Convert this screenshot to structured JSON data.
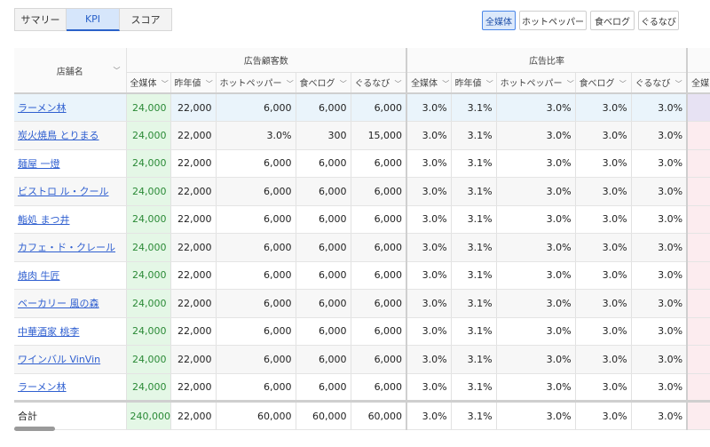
{
  "tabs": [
    {
      "label": "サマリー"
    },
    {
      "label": "KPI"
    },
    {
      "label": "スコア"
    }
  ],
  "filters": [
    {
      "label": "全媒体"
    },
    {
      "label": "ホットペッパー"
    },
    {
      "label": "食べログ"
    },
    {
      "label": "ぐるなび"
    }
  ],
  "header": {
    "store": "店舗名",
    "group1": "広告顧客数",
    "group2": "広告比率",
    "sub": [
      "全媒体",
      "昨年値",
      "ホットペッパー",
      "食べログ",
      "ぐるなび"
    ],
    "next_sub": "全媒"
  },
  "rows": [
    {
      "store": "ラーメン林",
      "c": [
        "24,000",
        "22,000",
        "6,000",
        "6,000",
        "6,000"
      ],
      "r": [
        "3.0%",
        "3.1%",
        "3.0%",
        "3.0%",
        "3.0%"
      ]
    },
    {
      "store": "炭火焼鳥 とりまる",
      "c": [
        "24,000",
        "22,000",
        "3.0%",
        "300",
        "15,000"
      ],
      "r": [
        "3.0%",
        "3.1%",
        "3.0%",
        "3.0%",
        "3.0%"
      ]
    },
    {
      "store": "麺屋 一燈",
      "c": [
        "24,000",
        "22,000",
        "6,000",
        "6,000",
        "6,000"
      ],
      "r": [
        "3.0%",
        "3.1%",
        "3.0%",
        "3.0%",
        "3.0%"
      ]
    },
    {
      "store": "ビストロ ル・クール",
      "c": [
        "24,000",
        "22,000",
        "6,000",
        "6,000",
        "6,000"
      ],
      "r": [
        "3.0%",
        "3.1%",
        "3.0%",
        "3.0%",
        "3.0%"
      ]
    },
    {
      "store": "鮨処 まつ井",
      "c": [
        "24,000",
        "22,000",
        "6,000",
        "6,000",
        "6,000"
      ],
      "r": [
        "3.0%",
        "3.1%",
        "3.0%",
        "3.0%",
        "3.0%"
      ]
    },
    {
      "store": "カフェ・ド・クレール",
      "c": [
        "24,000",
        "22,000",
        "6,000",
        "6,000",
        "6,000"
      ],
      "r": [
        "3.0%",
        "3.1%",
        "3.0%",
        "3.0%",
        "3.0%"
      ]
    },
    {
      "store": "焼肉 牛匠",
      "c": [
        "24,000",
        "22,000",
        "6,000",
        "6,000",
        "6,000"
      ],
      "r": [
        "3.0%",
        "3.1%",
        "3.0%",
        "3.0%",
        "3.0%"
      ]
    },
    {
      "store": "ベーカリー 風の森",
      "c": [
        "24,000",
        "22,000",
        "6,000",
        "6,000",
        "6,000"
      ],
      "r": [
        "3.0%",
        "3.1%",
        "3.0%",
        "3.0%",
        "3.0%"
      ]
    },
    {
      "store": "中華酒家 桃李",
      "c": [
        "24,000",
        "22,000",
        "6,000",
        "6,000",
        "6,000"
      ],
      "r": [
        "3.0%",
        "3.1%",
        "3.0%",
        "3.0%",
        "3.0%"
      ]
    },
    {
      "store": "ワインバル VinVin",
      "c": [
        "24,000",
        "22,000",
        "6,000",
        "6,000",
        "6,000"
      ],
      "r": [
        "3.0%",
        "3.1%",
        "3.0%",
        "3.0%",
        "3.0%"
      ]
    },
    {
      "store": "ラーメン林",
      "c": [
        "24,000",
        "22,000",
        "6,000",
        "6,000",
        "6,000"
      ],
      "r": [
        "3.0%",
        "3.1%",
        "3.0%",
        "3.0%",
        "3.0%"
      ]
    }
  ],
  "total": {
    "label": "合計",
    "c": [
      "240,000",
      "22,000",
      "60,000",
      "60,000",
      "60,000"
    ],
    "r": [
      "3.0%",
      "3.1%",
      "3.0%",
      "3.0%",
      "3.0%"
    ]
  }
}
